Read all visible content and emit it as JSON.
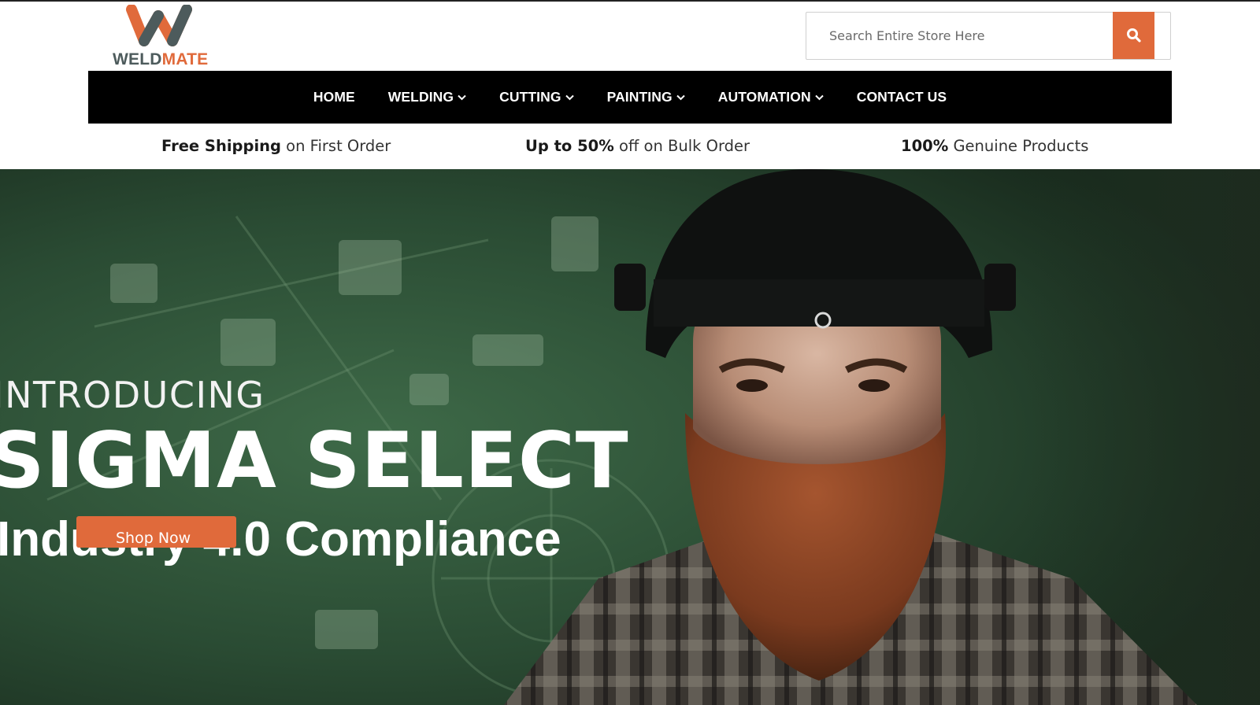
{
  "brand": {
    "name_part1": "WELD",
    "name_part2": "MATE",
    "accent_color": "#e06a3b",
    "secondary_color": "#4d5b5c"
  },
  "search": {
    "placeholder": "Search Entire Store Here",
    "button_icon": "search-icon"
  },
  "nav": {
    "items": [
      {
        "label": "HOME",
        "has_dropdown": false
      },
      {
        "label": "WELDING",
        "has_dropdown": true
      },
      {
        "label": "CUTTING",
        "has_dropdown": true
      },
      {
        "label": "PAINTING",
        "has_dropdown": true
      },
      {
        "label": "AUTOMATION",
        "has_dropdown": true
      },
      {
        "label": "CONTACT US",
        "has_dropdown": false
      }
    ],
    "dropdown_icon": "chevron-down-icon"
  },
  "promos": [
    {
      "bold": "Free Shipping",
      "text": " on First Order"
    },
    {
      "bold": "Up to 50%",
      "text": " off on Bulk Order"
    },
    {
      "bold": "100%",
      "text": " Genuine Products"
    }
  ],
  "hero": {
    "kicker": "INTRODUCING",
    "title": "SIGMA SELECT",
    "subtitle": "Industry 4.0 Compliance",
    "button_label": "Shop Now",
    "background_image": "welder-portrait"
  }
}
